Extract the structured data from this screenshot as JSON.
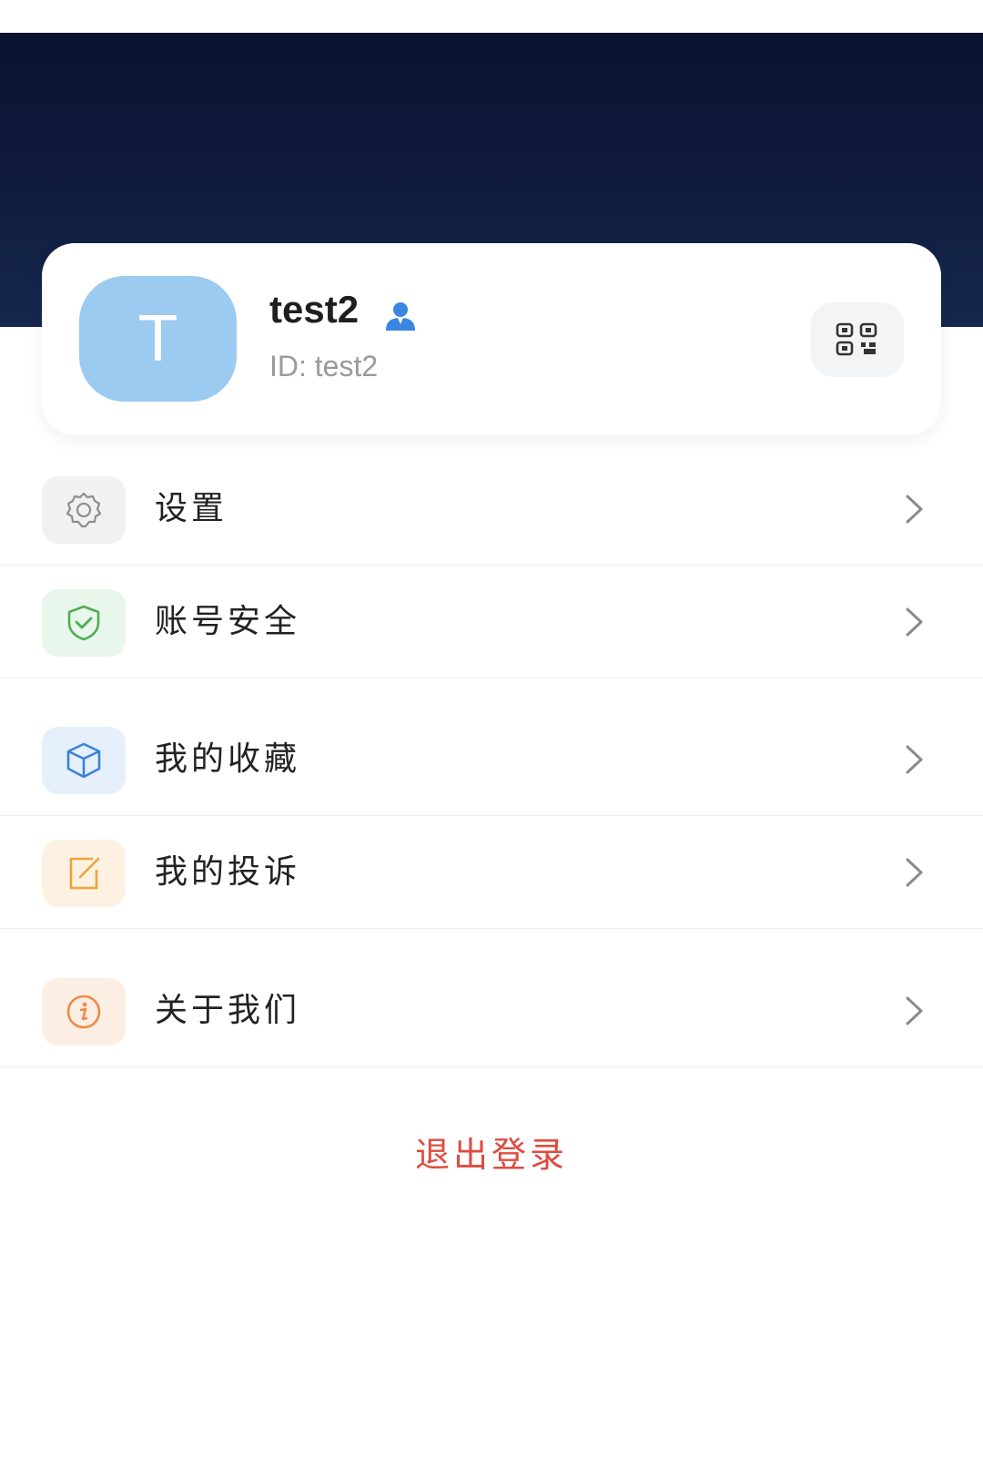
{
  "profile": {
    "avatar_letter": "T",
    "username": "test2",
    "user_id": "ID: test2",
    "badge_icon": "user-badge-icon",
    "qr_icon": "qr-code-icon"
  },
  "menu": {
    "items": [
      {
        "label": "设置",
        "icon": "gear-icon",
        "color": "#8e8e8e",
        "bg": "#f1f1f1"
      },
      {
        "label": "账号安全",
        "icon": "shield-check-icon",
        "color": "#4caf50",
        "bg": "#e9f6ec"
      },
      {
        "label": "我的收藏",
        "icon": "cube-icon",
        "color": "#3b82d6",
        "bg": "#e5f0fc"
      },
      {
        "label": "我的投诉",
        "icon": "edit-icon",
        "color": "#f1a23a",
        "bg": "#fdf1e1"
      },
      {
        "label": "关于我们",
        "icon": "info-icon",
        "color": "#ee8a4a",
        "bg": "#fdeee3"
      }
    ]
  },
  "logout_label": "退出登录",
  "colors": {
    "banner": "#0f1a3c",
    "avatar": "#9ccbf1",
    "logout": "#e04b3f"
  }
}
